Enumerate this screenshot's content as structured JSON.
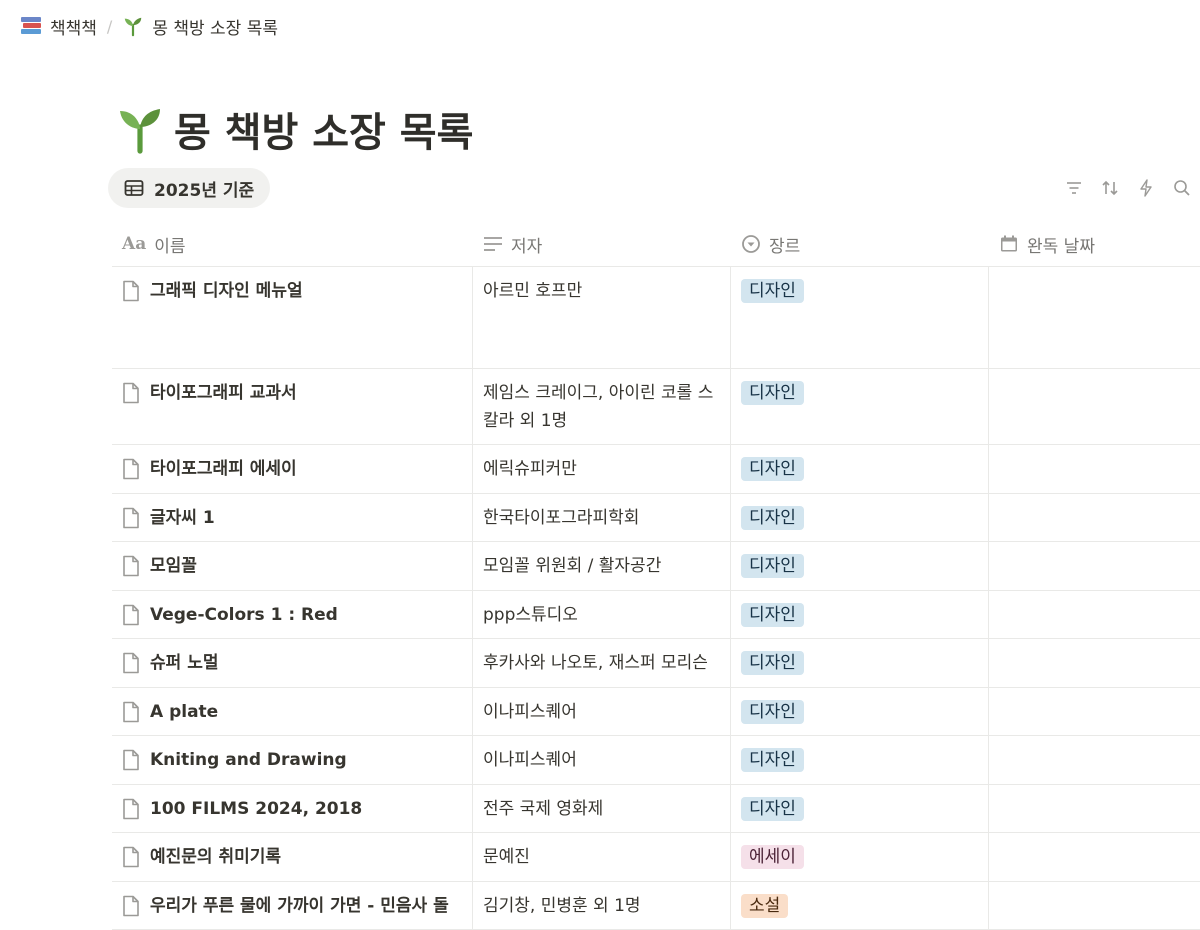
{
  "breadcrumb": {
    "workspace": "책책책",
    "page": "몽 책방 소장 목록"
  },
  "title": "몽 책방 소장 목록",
  "view_tab": {
    "label": "2025년 기준"
  },
  "columns": {
    "name": "이름",
    "author": "저자",
    "genre": "장르",
    "date": "완독 날짜"
  },
  "genre_colors": {
    "디자인": {
      "bg": "#d3e5ef",
      "fg": "#183347"
    },
    "에세이": {
      "bg": "#f5e0e9",
      "fg": "#4c2337"
    },
    "소설": {
      "bg": "#fadec9",
      "fg": "#49290e"
    }
  },
  "rows": [
    {
      "name": "그래픽 디자인 메뉴얼",
      "author": "아르민 호프만",
      "genre": "디자인",
      "date": "",
      "size": "tall"
    },
    {
      "name": "타이포그래피 교과서",
      "author": "제임스 크레이그, 아이린 코롤 스칼라 외 1명",
      "genre": "디자인",
      "date": "",
      "size": "two"
    },
    {
      "name": "타이포그래피 에세이",
      "author": "에릭슈피커만",
      "genre": "디자인",
      "date": "",
      "size": "one"
    },
    {
      "name": "글자씨 1",
      "author": "한국타이포그라피학회",
      "genre": "디자인",
      "date": "",
      "size": "one"
    },
    {
      "name": "모임꼴",
      "author": "모임꼴 위원회 / 활자공간",
      "genre": "디자인",
      "date": "",
      "size": "one"
    },
    {
      "name": "Vege-Colors 1 : Red",
      "author": "ppp스튜디오",
      "genre": "디자인",
      "date": "",
      "size": "one"
    },
    {
      "name": "슈퍼 노멀",
      "author": "후카사와 나오토, 재스퍼 모리슨",
      "genre": "디자인",
      "date": "",
      "size": "one"
    },
    {
      "name": "A plate",
      "author": "이나피스퀘어",
      "genre": "디자인",
      "date": "",
      "size": "one"
    },
    {
      "name": "Kniting and Drawing",
      "author": "이나피스퀘어",
      "genre": "디자인",
      "date": "",
      "size": "one"
    },
    {
      "name": "100 FILMS 2024, 2018",
      "author": "전주 국제 영화제",
      "genre": "디자인",
      "date": "",
      "size": "one"
    },
    {
      "name": "예진문의 취미기록",
      "author": "문예진",
      "genre": "에세이",
      "date": "",
      "size": "one"
    },
    {
      "name": "우리가 푸른 물에 가까이 가면 - 민음사 돌",
      "author": "김기창, 민병훈 외 1명",
      "genre": "소설",
      "date": "",
      "size": "one"
    }
  ]
}
